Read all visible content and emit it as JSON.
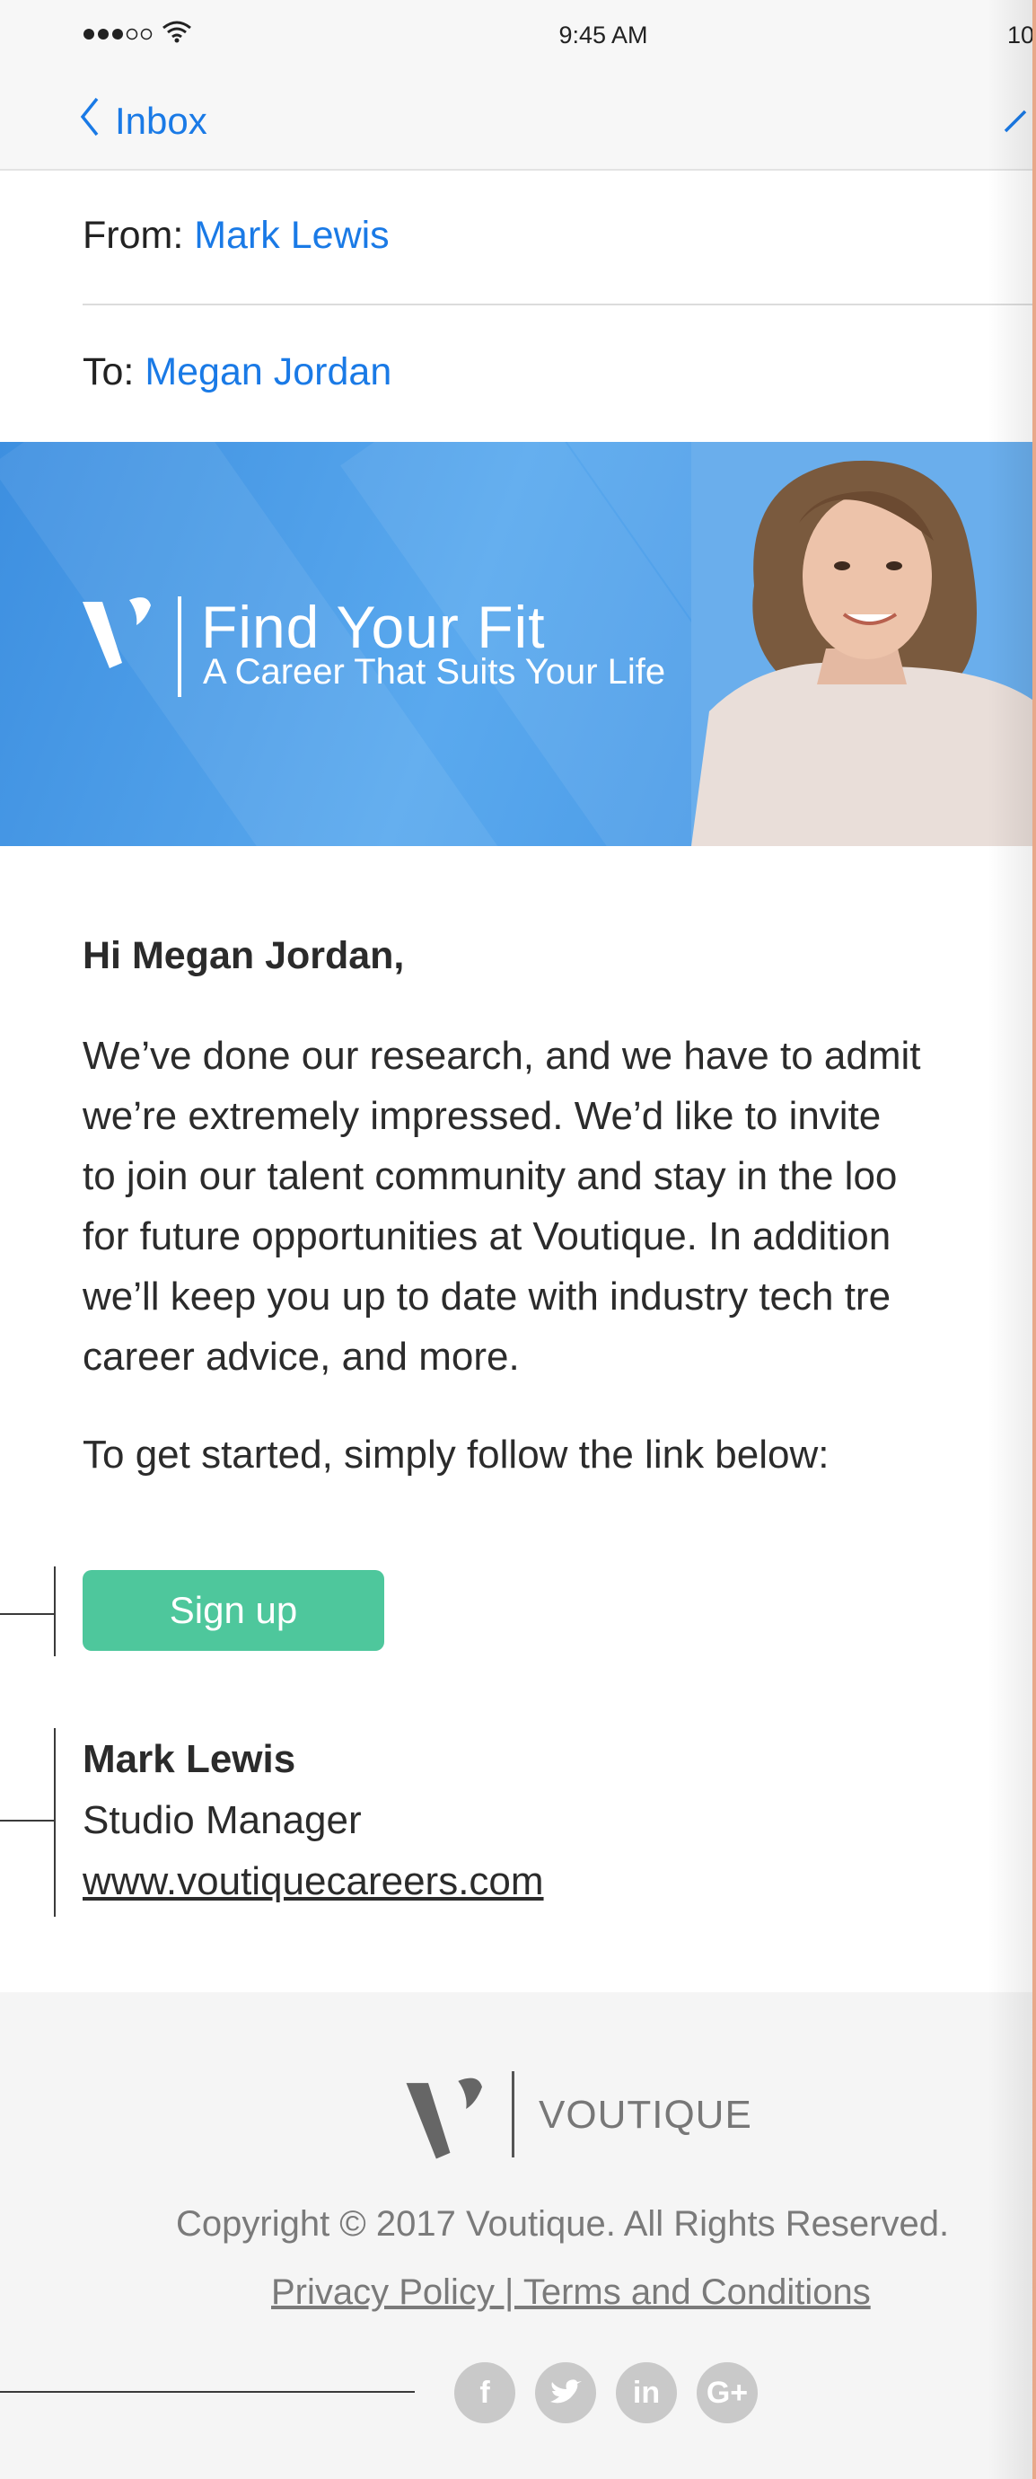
{
  "status": {
    "time": "9:45 AM",
    "battery": "10"
  },
  "nav": {
    "back_label": "Inbox"
  },
  "email": {
    "from_label": "From:",
    "from_name": "Mark Lewis",
    "to_label": "To:",
    "to_name": "Megan Jordan"
  },
  "banner": {
    "title": "Find Your Fit",
    "subtitle": "A Career That Suits Your Life"
  },
  "body": {
    "greeting": "Hi Megan Jordan,",
    "lines": [
      "We’ve done our research, and we have to admit",
      "we’re extremely impressed.  We’d like to invite",
      "to join our talent community and stay in the loo",
      "for future opportunities at Voutique. In addition",
      "we’ll keep you up to date with industry tech tre",
      "career advice, and more."
    ],
    "cta_intro": "To get started, simply follow the link below:",
    "button_label": "Sign up"
  },
  "signature": {
    "name": "Mark Lewis",
    "role": "Studio Manager",
    "website": "www.voutiquecareers.com"
  },
  "footer": {
    "brand": "VOUTIQUE",
    "copyright": "Copyright © 2017 Voutique. All Rights Reserved.",
    "links": "Privacy Policy | Terms and Conditions",
    "social": [
      {
        "icon": "facebook-icon",
        "glyph": "f"
      },
      {
        "icon": "twitter-icon",
        "glyph": "🐦"
      },
      {
        "icon": "linkedin-icon",
        "glyph": "in"
      },
      {
        "icon": "googleplus-icon",
        "glyph": "G+"
      }
    ]
  },
  "colors": {
    "link_blue": "#1a7ae6",
    "banner_blue": "#4d9de8",
    "button_green": "#4ec79c",
    "footer_gray": "#f5f5f5"
  }
}
